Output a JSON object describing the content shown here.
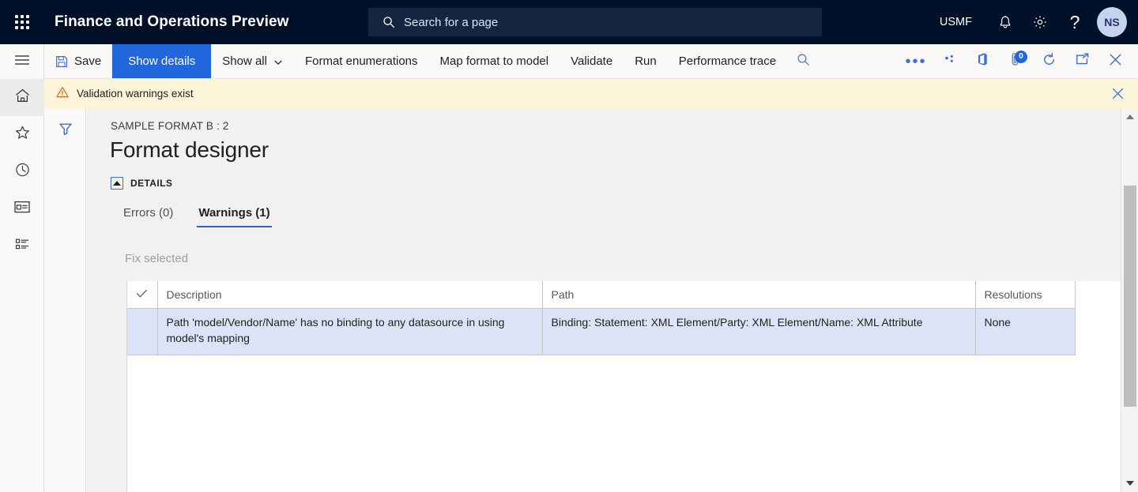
{
  "topnav": {
    "waffle_label": "App launcher",
    "app_title": "Finance and Operations Preview",
    "search_placeholder": "Search for a page",
    "company": "USMF",
    "notifications_label": "Notifications",
    "settings_label": "Settings",
    "help_label": "?",
    "avatar_initials": "NS"
  },
  "commandbar": {
    "save": "Save",
    "show_details": "Show details",
    "show_all": "Show all",
    "format_enumerations": "Format enumerations",
    "map_format_to_model": "Map format to model",
    "validate": "Validate",
    "run": "Run",
    "performance_trace": "Performance trace",
    "search_label": "Search",
    "more_label": "More options",
    "attachments_badge": "0"
  },
  "validation_bar": {
    "message": "Validation warnings exist",
    "close_label": "Close"
  },
  "rail": {
    "items": [
      {
        "name": "hamburger-menu",
        "label": "Expand the navigation pane"
      },
      {
        "name": "home",
        "label": "Home"
      },
      {
        "name": "favorites",
        "label": "Favorites"
      },
      {
        "name": "recent",
        "label": "Recent"
      },
      {
        "name": "workspaces",
        "label": "Workspaces"
      },
      {
        "name": "modules",
        "label": "Modules"
      }
    ]
  },
  "filter_rail": {
    "filter_label": "Filter"
  },
  "page": {
    "breadcrumb": "SAMPLE FORMAT B : 2",
    "title": "Format designer",
    "details_section_label": "DETAILS",
    "tabs": [
      {
        "label": "Errors (0)",
        "active": false
      },
      {
        "label": "Warnings (1)",
        "active": true
      }
    ],
    "fix_selected_label": "Fix selected"
  },
  "grid": {
    "columns": [
      "Description",
      "Path",
      "Resolutions"
    ],
    "check_column_label": "Select all",
    "rows": [
      {
        "selected": true,
        "description": "Path 'model/Vendor/Name' has no binding to any datasource in using model's mapping",
        "path": "Binding: Statement: XML Element/Party: XML Element/Name: XML Attribute",
        "resolutions": "None"
      }
    ]
  },
  "scrollbar": {
    "up_label": "Scroll up",
    "down_label": "Scroll down",
    "thumb_label": "Vertical scroll thumb"
  },
  "colors": {
    "nav_bg": "#001029",
    "accent": "#2266dd",
    "warning_bg": "#fdf5d9",
    "selected_row": "#dbe4f6",
    "content_bg": "#f2f1f0"
  }
}
